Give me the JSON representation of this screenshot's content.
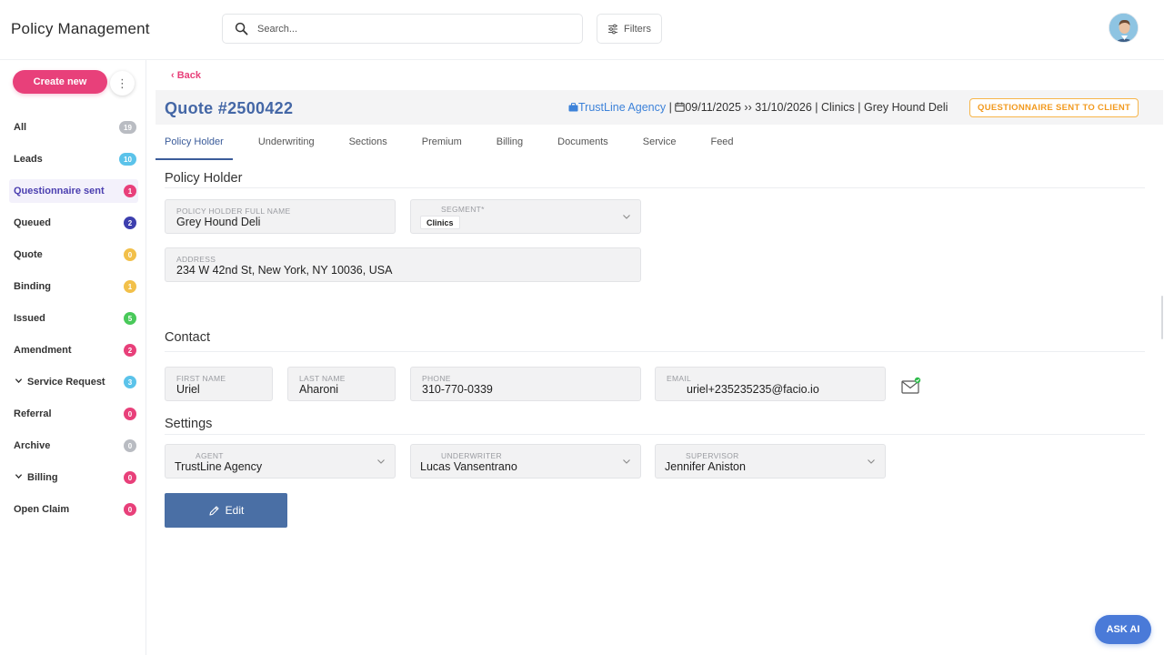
{
  "app": {
    "title": "Policy Management"
  },
  "search": {
    "placeholder": "Search..."
  },
  "filters": {
    "label": "Filters",
    "icon": "sliders-icon"
  },
  "user": {
    "avatar": "user-avatar"
  },
  "sidebar": {
    "create_label": "Create new",
    "more_icon": "⋮",
    "items": [
      {
        "label": "All",
        "count": "19",
        "color": "#b9bcc2",
        "expand": false,
        "active": false
      },
      {
        "label": "Leads",
        "count": "10",
        "color": "#5bc3ea",
        "expand": false,
        "active": false
      },
      {
        "label": "Questionnaire sent",
        "count": "1",
        "color": "#e8407a",
        "expand": false,
        "active": true
      },
      {
        "label": "Queued",
        "count": "2",
        "color": "#3d3fae",
        "expand": false,
        "active": false
      },
      {
        "label": "Quote",
        "count": "0",
        "color": "#f2c04a",
        "expand": false,
        "active": false
      },
      {
        "label": "Binding",
        "count": "1",
        "color": "#f2c04a",
        "expand": false,
        "active": false
      },
      {
        "label": "Issued",
        "count": "5",
        "color": "#49c95a",
        "expand": false,
        "active": false
      },
      {
        "label": "Amendment",
        "count": "2",
        "color": "#e8407a",
        "expand": false,
        "active": false
      },
      {
        "label": "Service Request",
        "count": "3",
        "color": "#5bc3ea",
        "expand": true,
        "active": false
      },
      {
        "label": "Referral",
        "count": "0",
        "color": "#e8407a",
        "expand": false,
        "active": false
      },
      {
        "label": "Archive",
        "count": "0",
        "color": "#b9bcc2",
        "expand": false,
        "active": false
      },
      {
        "label": "Billing",
        "count": "0",
        "color": "#e8407a",
        "expand": true,
        "active": false
      },
      {
        "label": "Open Claim",
        "count": "0",
        "color": "#e8407a",
        "expand": false,
        "active": false
      }
    ]
  },
  "main": {
    "back_label": "Back",
    "quote_title": "Quote #2500422",
    "meta": {
      "agency": "TrustLine Agency",
      "sep1": " | ",
      "dates": "09/11/2025 ›› 31/10/2026",
      "sep2": " | ",
      "segment": "Clinics",
      "sep3": " | ",
      "holder": "Grey Hound Deli"
    },
    "status": "QUESTIONNAIRE SENT TO CLIENT",
    "tabs": [
      "Policy Holder",
      "Underwriting",
      "Sections",
      "Premium",
      "Billing",
      "Documents",
      "Service",
      "Feed"
    ],
    "active_tab": "Policy Holder",
    "policy_holder": {
      "section_title": "Policy Holder",
      "full_name_label": "POLICY HOLDER FULL NAME",
      "full_name": "Grey Hound Deli",
      "segment_label": "SEGMENT*",
      "segment": "Clinics",
      "address_label": "ADDRESS",
      "address": "234 W 42nd St, New York, NY 10036, USA"
    },
    "contact": {
      "section_title": "Contact",
      "first_name_label": "FIRST NAME",
      "first_name": "Uriel",
      "last_name_label": "LAST NAME",
      "last_name": "Aharoni",
      "phone_label": "PHONE",
      "phone": "310-770-0339",
      "email_label": "EMAIL",
      "email": "uriel+235235235@facio.io",
      "email_icon": "mail-verified-icon"
    },
    "settings": {
      "section_title": "Settings",
      "agent_label": "AGENT",
      "agent": "TrustLine Agency",
      "underwriter_label": "UNDERWRITER",
      "underwriter": "Lucas Vansentrano",
      "supervisor_label": "SUPERVISOR",
      "supervisor": "Jennifer Aniston"
    },
    "edit_label": "Edit"
  },
  "ask_ai": {
    "label": "ASK AI"
  }
}
